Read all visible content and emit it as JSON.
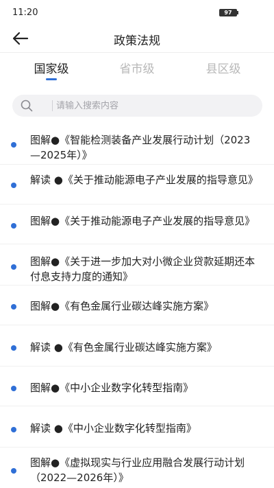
{
  "status_bar": {
    "time": "11:20",
    "battery": "97"
  },
  "header": {
    "title": "政策法规"
  },
  "tabs": [
    {
      "label": "国家级",
      "active": true
    },
    {
      "label": "省市级",
      "active": false
    },
    {
      "label": "县区级",
      "active": false
    }
  ],
  "search": {
    "placeholder": "请输入搜索内容",
    "value": ""
  },
  "items": [
    {
      "title": "图解●《智能检测装备产业发展行动计划（2023—2025年）》"
    },
    {
      "title": "解读 ●《关于推动能源电子产业发展的指导意见》"
    },
    {
      "title": "图解●《关于推动能源电子产业发展的指导意见》"
    },
    {
      "title": "图解●《关于进一步加大对小微企业贷款延期还本付息支持力度的通知》"
    },
    {
      "title": "图解●《有色金属行业碳达峰实施方案》"
    },
    {
      "title": "解读 ●《有色金属行业碳达峰实施方案》"
    },
    {
      "title": "图解●《中小企业数字化转型指南》"
    },
    {
      "title": "解读 ●《中小企业数字化转型指南》"
    },
    {
      "title": "图解●《虚拟现实与行业应用融合发展行动计划（2022—2026年）》"
    }
  ],
  "colors": {
    "accent": "#2f6fd6",
    "inactive_tab": "#b8b8b8",
    "search_bg": "#f2f2f4"
  }
}
